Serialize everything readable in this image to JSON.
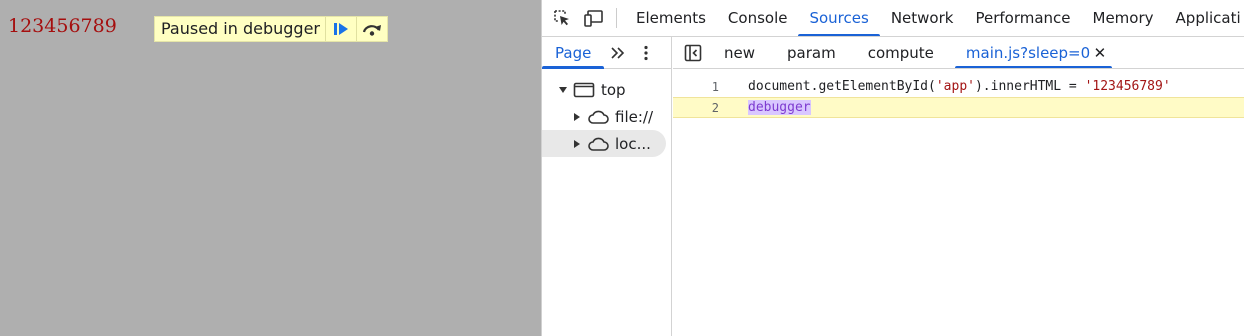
{
  "page": {
    "app_text": "123456789",
    "paused_label": "Paused in debugger",
    "resume_icon": "resume-icon",
    "step_over_icon": "step-over-icon"
  },
  "devtools": {
    "main_tabs": [
      "Elements",
      "Console",
      "Sources",
      "Network",
      "Performance",
      "Memory",
      "Applicati"
    ],
    "active_main_tab": "Sources",
    "navigator": {
      "tab": "Page",
      "tree": [
        {
          "label": "top",
          "icon": "frame-icon",
          "expanded": true
        },
        {
          "label": "file://",
          "icon": "cloud-icon",
          "expanded": false
        },
        {
          "label": "loc...",
          "icon": "cloud-icon",
          "expanded": false
        }
      ]
    },
    "editor_tabs": [
      "new",
      "param",
      "compute",
      "main.js?sleep=0"
    ],
    "active_editor_tab": "main.js?sleep=0",
    "code": {
      "line_numbers": [
        "1",
        "2"
      ],
      "line1_a": "document.getElementById(",
      "line1_str1": "'app'",
      "line1_b": ").innerHTML = ",
      "line1_str2": "'123456789'",
      "line2": "debugger"
    }
  },
  "colors": {
    "accent": "#1a62d6",
    "page_bg": "#afafaf",
    "app_text": "#a50e0e",
    "paused_bg": "#ffffc2"
  }
}
